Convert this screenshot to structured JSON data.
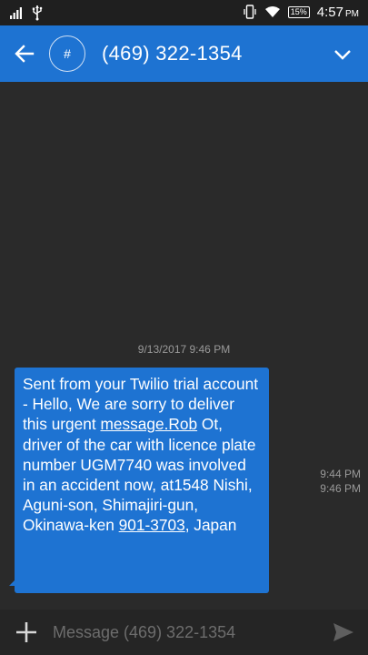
{
  "status_bar": {
    "time": "4:57",
    "ampm": "PM",
    "battery": "15%",
    "icons": [
      "signal-icon",
      "usb-icon",
      "vibrate-icon",
      "wifi-icon",
      "battery-icon"
    ]
  },
  "header": {
    "avatar_label": "#",
    "title": "(469) 322-1354"
  },
  "conversation": {
    "date_separator": "9/13/2017 9:46 PM",
    "message": {
      "text_1": "Sent from your Twilio trial account - Hello, We are sorry to deliver this urgent ",
      "link_1": "message.Rob",
      "text_2": " Ot, driver of the car with licence plate number UGM7740 was involved in an accident now, at1548 Nishi, Aguni-son, Shimajiri-gun, Okinawa-ken ",
      "link_2": "901-3703",
      "text_3": ", Japan"
    },
    "timestamps": [
      "9:44 PM",
      "9:46 PM"
    ]
  },
  "composer": {
    "placeholder": "Message (469) 322-1354"
  },
  "colors": {
    "accent": "#1e73d2",
    "background": "#2a2a2a",
    "muted_text": "#9a9a9a"
  }
}
